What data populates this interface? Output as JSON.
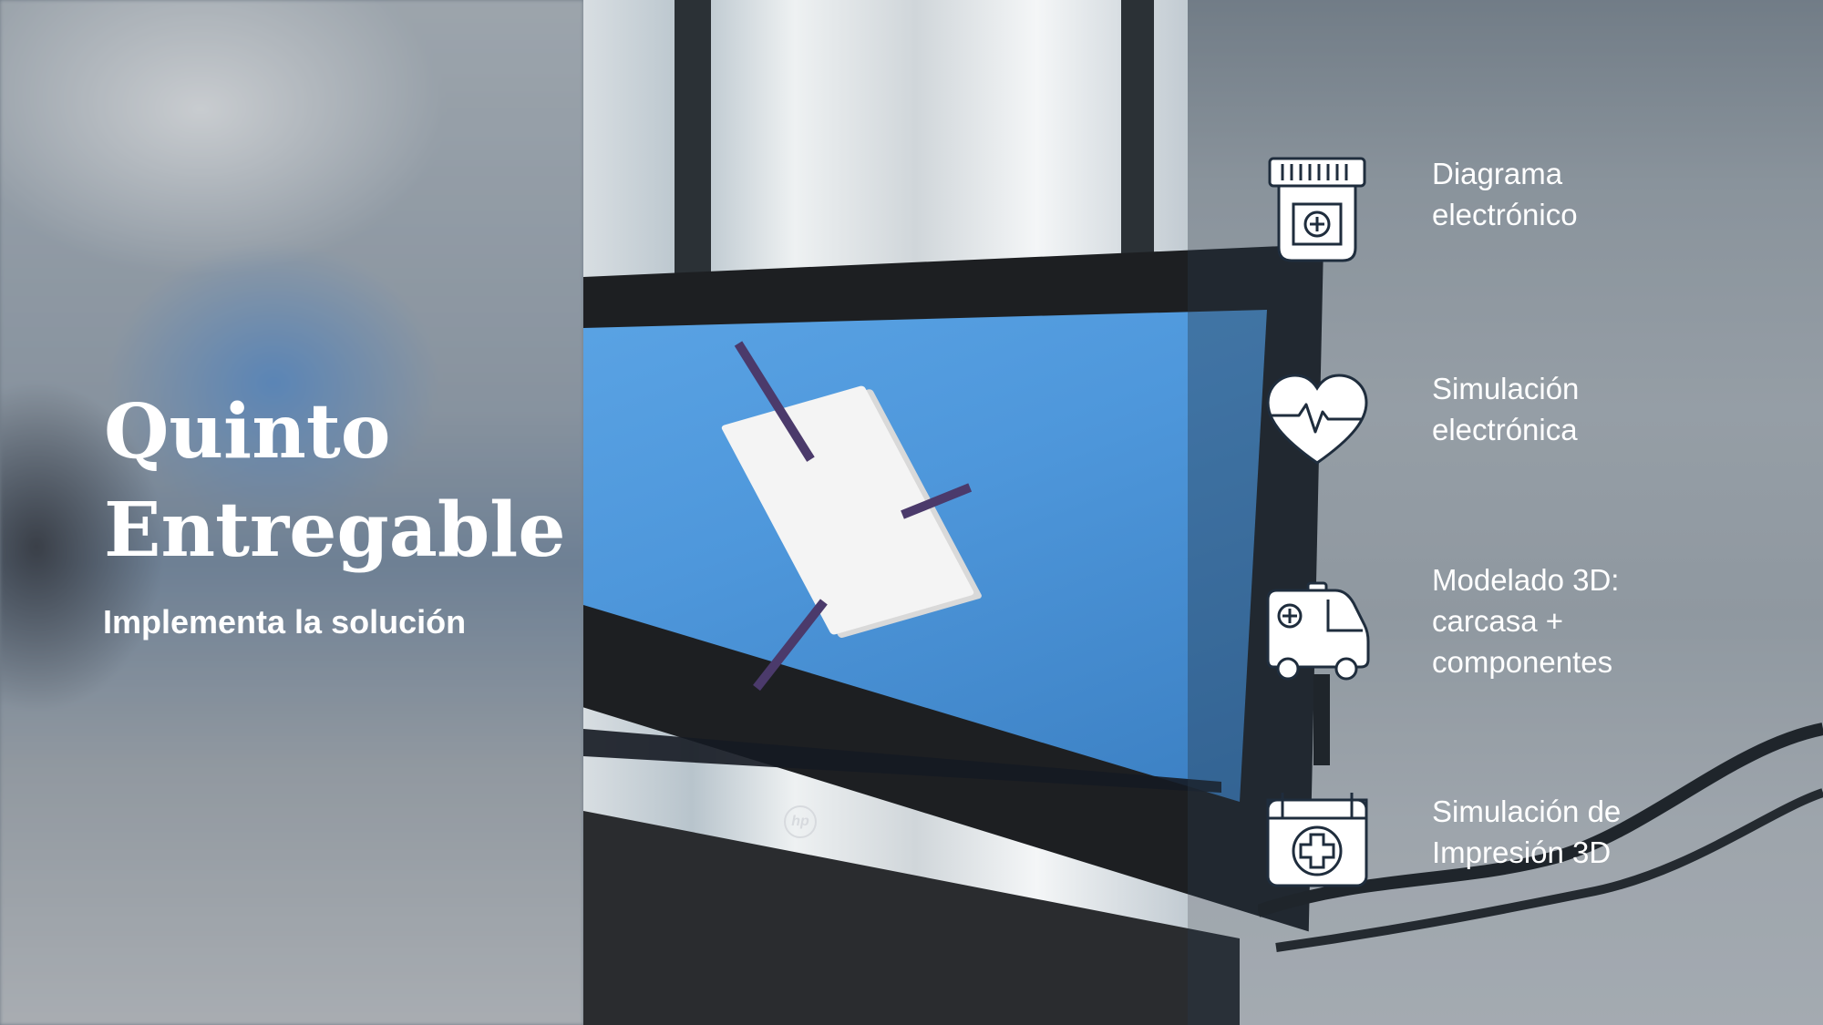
{
  "slide": {
    "title_line1": "Quinto",
    "title_line2": "Entregable",
    "subtitle": "Implementa la solución"
  },
  "items": [
    {
      "icon": "medicine-jar-icon",
      "label": "Diagrama\nelectrónico"
    },
    {
      "icon": "heart-pulse-icon",
      "label": "Simulación\nelectrónica"
    },
    {
      "icon": "ambulance-icon",
      "label": "Modelado 3D:\ncarcasa +\ncomponentes"
    },
    {
      "icon": "first-aid-kit-icon",
      "label": "Simulación de\nImpresión 3D"
    }
  ],
  "colors": {
    "text": "#ffffff",
    "icon": "#ffffff",
    "icon_stroke": "#1f2d3d"
  }
}
